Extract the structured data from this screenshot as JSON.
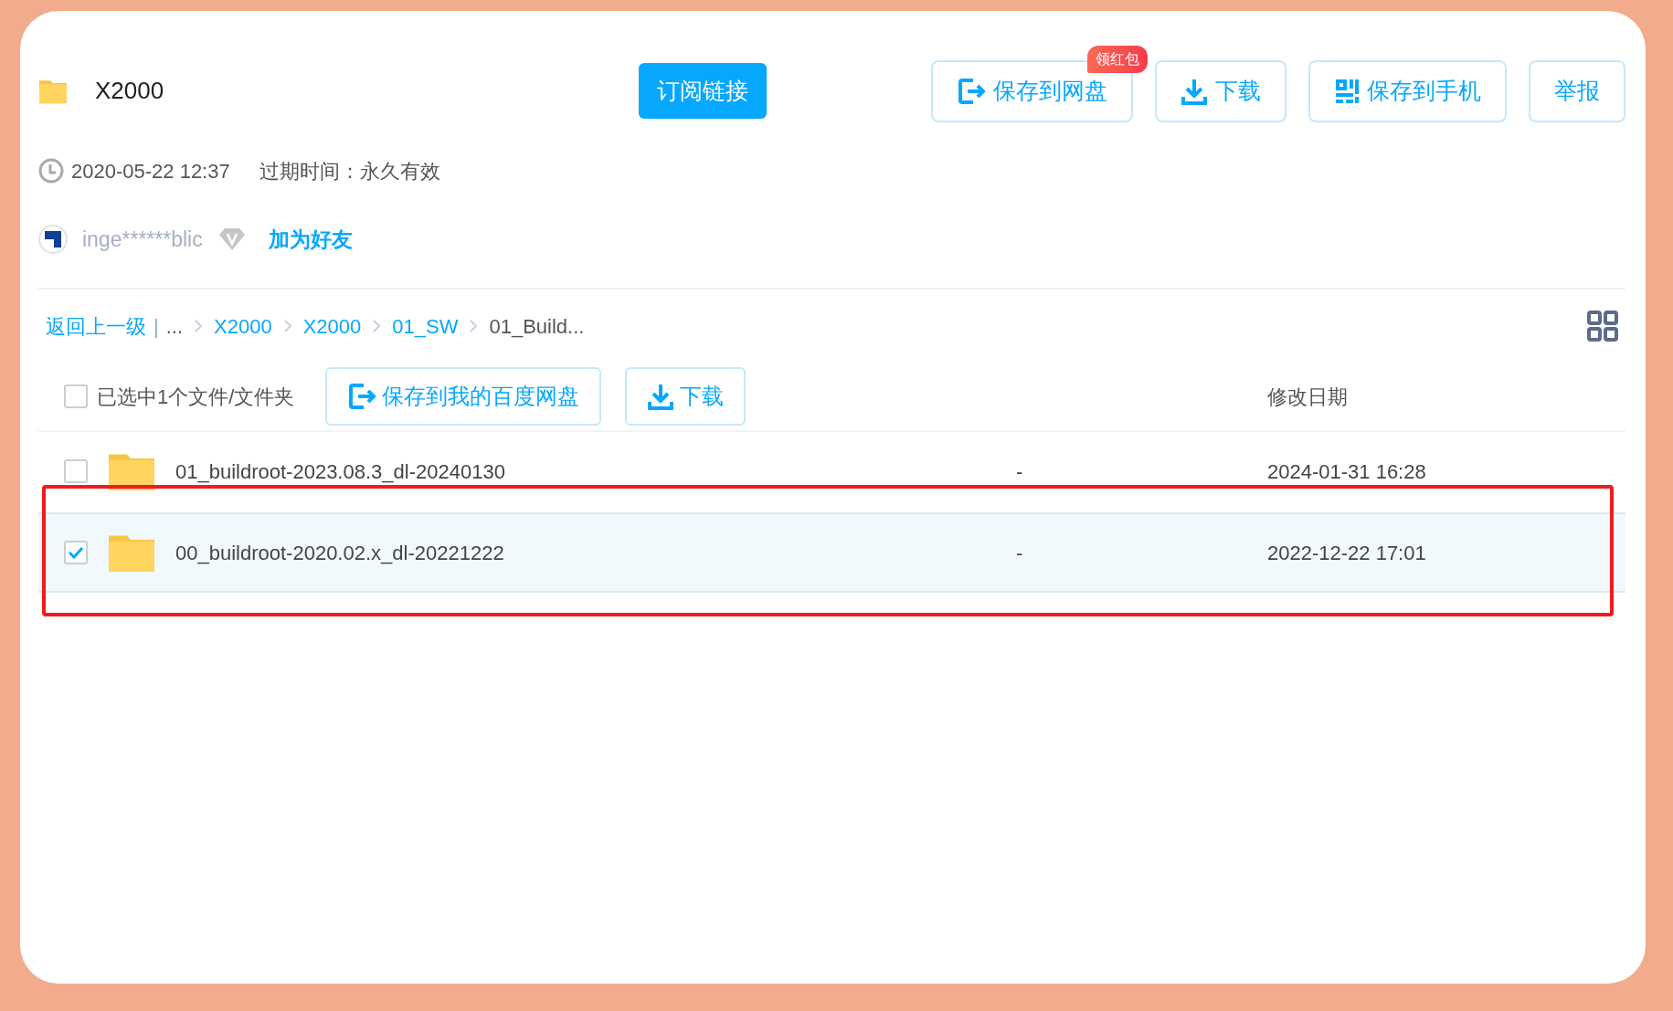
{
  "header": {
    "title": "X2000",
    "subscribe_button": "订阅链接",
    "actions": [
      {
        "label": "保存到网盘",
        "kind": "save",
        "badge": "领红包"
      },
      {
        "label": "下载",
        "kind": "download"
      },
      {
        "label": "保存到手机",
        "kind": "qr"
      },
      {
        "label": "举报",
        "kind": "plain"
      }
    ]
  },
  "meta": {
    "date": "2020-05-22 12:37",
    "expiry": "过期时间：永久有效"
  },
  "user": {
    "name": "inge******blic",
    "add_friend": "加为好友"
  },
  "breadcrumb": {
    "back": "返回上一级",
    "separator": "|",
    "items": [
      {
        "label": "...",
        "kind": "text"
      },
      {
        "label": "X2000",
        "kind": "link"
      },
      {
        "label": "X2000",
        "kind": "link"
      },
      {
        "label": "01_SW",
        "kind": "link"
      },
      {
        "label": "01_Build...",
        "kind": "current"
      }
    ]
  },
  "toolbar": {
    "checked": false,
    "selection_label": "已选中1个文件/文件夹",
    "buttons": [
      {
        "label": "保存到我的百度网盘",
        "kind": "save"
      },
      {
        "label": "下载",
        "kind": "download"
      }
    ],
    "date_column": "修改日期"
  },
  "rows": [
    {
      "name": "01_buildroot-2023.08.3_dl-20240130",
      "size": "-",
      "date": "2024-01-31 16:28",
      "selected": false
    },
    {
      "name": "00_buildroot-2020.02.x_dl-20221222",
      "size": "-",
      "date": "2022-12-22 17:01",
      "selected": true
    }
  ],
  "highlight_frame": {
    "shown": true
  }
}
